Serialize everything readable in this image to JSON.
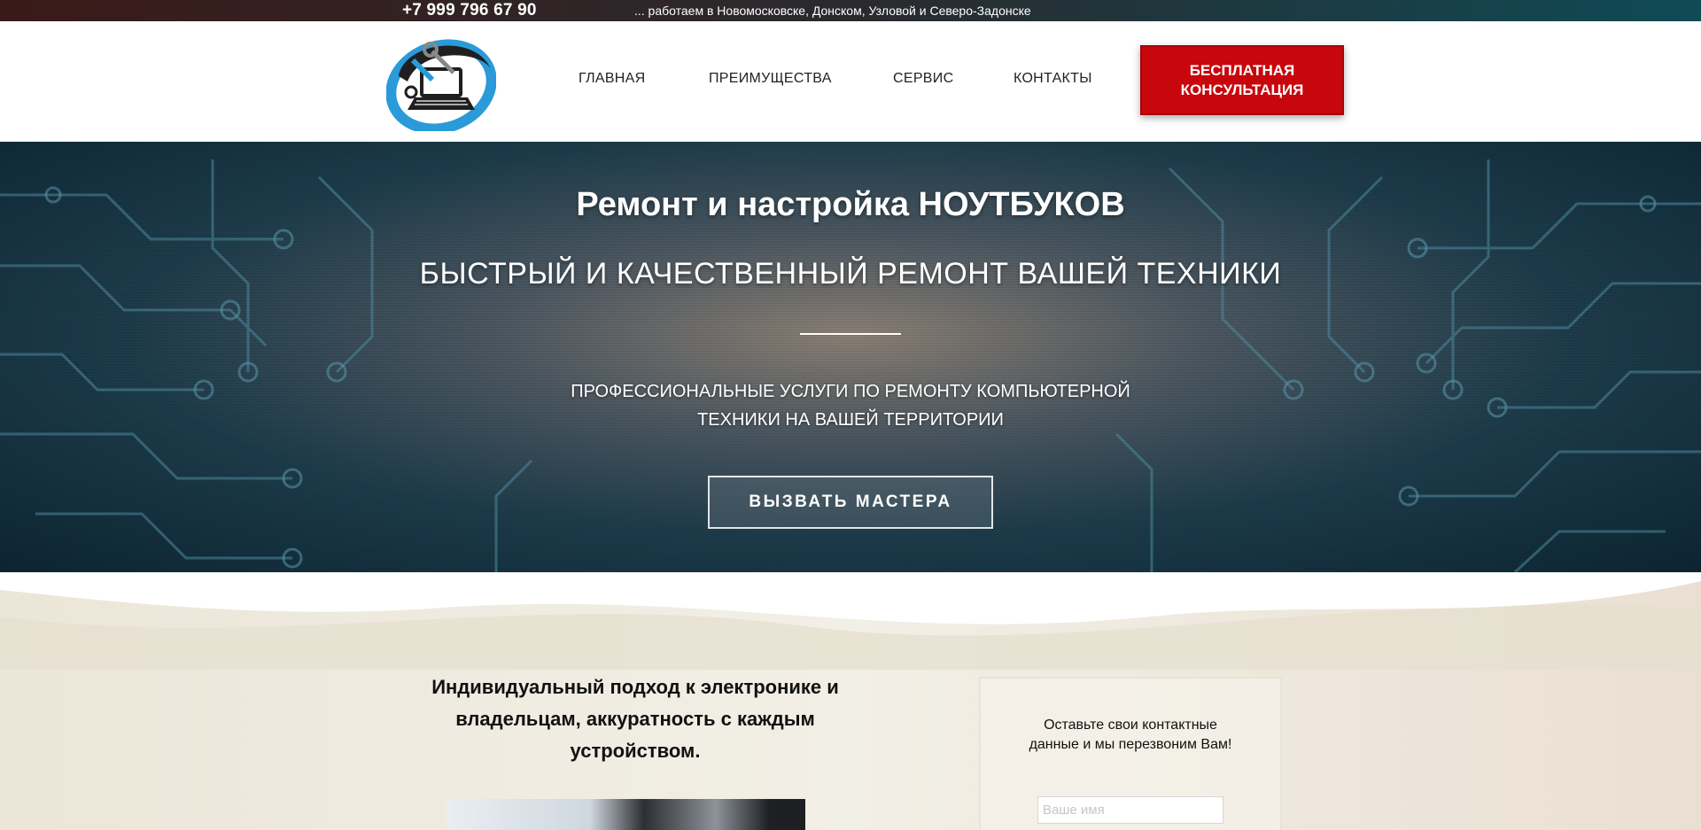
{
  "topbar": {
    "phone": "+7 999 796 67 90",
    "region": "... работаем в Новомосковске, Донском, Узловой и Северо-Задонске"
  },
  "header": {
    "logo_icon": "laptop-repair-logo",
    "nav": [
      {
        "label": "ГЛАВНАЯ"
      },
      {
        "label": "ПРЕИМУЩЕСТВА"
      },
      {
        "label": "СЕРВИС"
      },
      {
        "label": "КОНТАКТЫ"
      }
    ],
    "cta_line1": "БЕСПЛАТНАЯ",
    "cta_line2": "КОНСУЛЬТАЦИЯ",
    "cta_color": "#c8070c"
  },
  "hero": {
    "title": "Ремонт и настройка НОУТБУКОВ",
    "subtitle": "БЫСТРЫЙ И КАЧЕСТВЕННЫЙ РЕМОНТ ВАШЕЙ ТЕХНИКИ",
    "desc_line1": "ПРОФЕССИОНАЛЬНЫЕ УСЛУГИ ПО РЕМОНТУ КОМПЬЮТЕРНОЙ",
    "desc_line2": "ТЕХНИКИ НА ВАШЕЙ ТЕРРИТОРИИ",
    "button": "ВЫЗВАТЬ МАСТЕРА"
  },
  "lower": {
    "tagline_line1": "Индивидуальный подход к электронике и",
    "tagline_line2": "владельцам, аккуратность с каждым",
    "tagline_line3": "устройством.",
    "form_text_line1": "Оставьте свои контактные",
    "form_text_line2": "данные и мы перезвоним Вам!",
    "name_placeholder": "Ваше имя"
  }
}
